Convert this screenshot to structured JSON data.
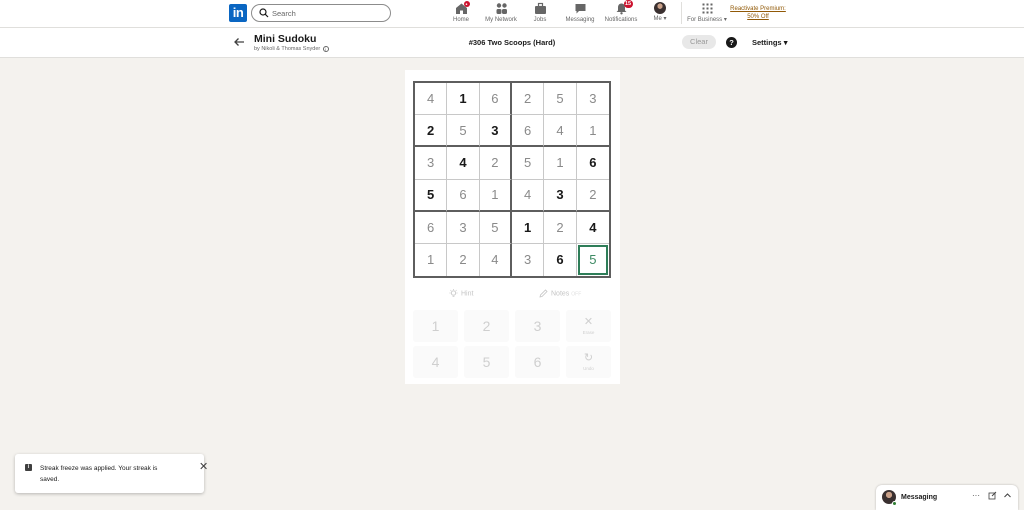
{
  "nav": {
    "logo_text": "in",
    "search_placeholder": "Search",
    "items": [
      {
        "label": "Home",
        "badge": "",
        "icon": "home-icon"
      },
      {
        "label": "My Network",
        "badge": "",
        "icon": "network-icon"
      },
      {
        "label": "Jobs",
        "badge": "",
        "icon": "jobs-icon"
      },
      {
        "label": "Messaging",
        "badge": "",
        "icon": "messaging-icon"
      },
      {
        "label": "Notifications",
        "badge": "15",
        "icon": "bell-icon"
      }
    ],
    "me_label": "Me",
    "business_label": "For Business",
    "premium_line1": "Reactivate Premium:",
    "premium_line2": "50% Off"
  },
  "header": {
    "game_title": "Mini Sudoku",
    "author": "by Nikoli & Thomas Snyder",
    "puzzle_title": "#306 Two Scoops (Hard)",
    "clear_label": "Clear",
    "help_label": "?",
    "settings_label": "Settings"
  },
  "grid": {
    "rows": [
      [
        "4",
        "1",
        "6",
        "2",
        "5",
        "3"
      ],
      [
        "2",
        "5",
        "3",
        "6",
        "4",
        "1"
      ],
      [
        "3",
        "4",
        "2",
        "5",
        "1",
        "6"
      ],
      [
        "5",
        "6",
        "1",
        "4",
        "3",
        "2"
      ],
      [
        "6",
        "3",
        "5",
        "1",
        "2",
        "4"
      ],
      [
        "1",
        "2",
        "4",
        "3",
        "6",
        "5"
      ]
    ],
    "given": [
      [
        0,
        1,
        0,
        0,
        0,
        0
      ],
      [
        1,
        0,
        1,
        0,
        0,
        0
      ],
      [
        0,
        1,
        0,
        0,
        0,
        1
      ],
      [
        1,
        0,
        0,
        0,
        1,
        0
      ],
      [
        0,
        0,
        0,
        1,
        0,
        1
      ],
      [
        0,
        0,
        0,
        0,
        1,
        0
      ]
    ],
    "selected": [
      5,
      5
    ]
  },
  "tools": {
    "hint_label": "Hint",
    "notes_label": "Notes",
    "notes_state": "OFF"
  },
  "numpad": {
    "keys": [
      "1",
      "2",
      "3",
      "4",
      "5",
      "6"
    ],
    "erase_label": "Erase",
    "undo_label": "Undo"
  },
  "toast": {
    "message": "Streak freeze was applied. Your streak is saved."
  },
  "messaging": {
    "label": "Messaging",
    "more": "···"
  },
  "colors": {
    "linkedin_blue": "#0a66c2",
    "selected_green": "#2e7d58",
    "badge_red": "#cb112d",
    "premium_gold": "#915907"
  }
}
